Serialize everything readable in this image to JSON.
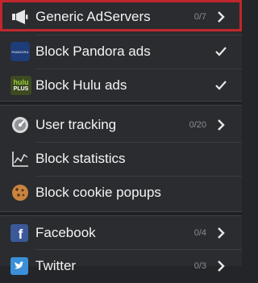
{
  "rows": {
    "generic_adservers": {
      "label": "Generic AdServers",
      "count": "0/7"
    },
    "pandora": {
      "label": "Block Pandora ads",
      "icon_text": "PANDORA"
    },
    "hulu": {
      "label": "Block Hulu ads",
      "icon_text_top": "hulu",
      "icon_text_bottom": "PLUS"
    },
    "user_tracking": {
      "label": "User tracking",
      "count": "0/20"
    },
    "block_statistics": {
      "label": "Block statistics"
    },
    "cookie_popups": {
      "label": "Block cookie popups"
    },
    "facebook": {
      "label": "Facebook",
      "count": "0/4"
    },
    "twitter": {
      "label": "Twitter",
      "count": "0/3"
    }
  },
  "colors": {
    "highlight": "#c1272d",
    "background": "#232528",
    "facebook": "#3b5998",
    "twitter": "#3a8fd8"
  },
  "icons": {
    "generic_adservers": "megaphone-icon",
    "pandora": "pandora-logo-icon",
    "hulu": "hulu-plus-logo-icon",
    "user_tracking": "tracking-gauge-icon",
    "block_statistics": "chart-icon",
    "cookie_popups": "cookie-icon",
    "facebook": "facebook-icon",
    "twitter": "twitter-icon"
  }
}
